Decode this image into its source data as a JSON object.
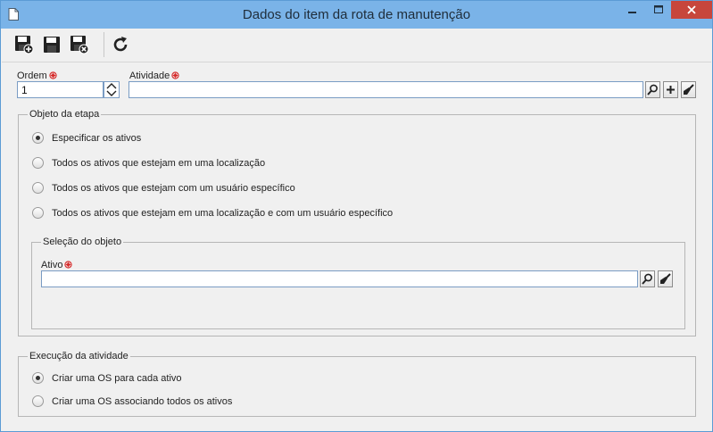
{
  "window": {
    "title": "Dados do item da rota de manutenção"
  },
  "toolbar": {
    "buttons": [
      "save-new-icon",
      "save-icon",
      "save-close-icon",
      "refresh-icon"
    ]
  },
  "fields": {
    "ordem_label": "Ordem",
    "ordem_value": "1",
    "atividade_label": "Atividade",
    "atividade_value": ""
  },
  "objeto_etapa": {
    "title": "Objeto da etapa",
    "options": [
      {
        "label": "Especificar os ativos",
        "checked": true
      },
      {
        "label": "Todos os ativos que estejam em uma localização",
        "checked": false
      },
      {
        "label": "Todos os ativos que estejam com um usuário específico",
        "checked": false
      },
      {
        "label": "Todos os ativos que estejam em uma localização e com um usuário específico",
        "checked": false
      }
    ],
    "selecao": {
      "title": "Seleção do objeto",
      "ativo_label": "Ativo",
      "ativo_value": ""
    }
  },
  "execucao": {
    "title": "Execução da atividade",
    "options": [
      {
        "label": "Criar uma OS para cada ativo",
        "checked": true
      },
      {
        "label": "Criar uma OS associando todos os ativos",
        "checked": false
      }
    ]
  },
  "colors": {
    "titlebar": "#7ab3e8",
    "close": "#c7463c",
    "required": "#d62828"
  }
}
